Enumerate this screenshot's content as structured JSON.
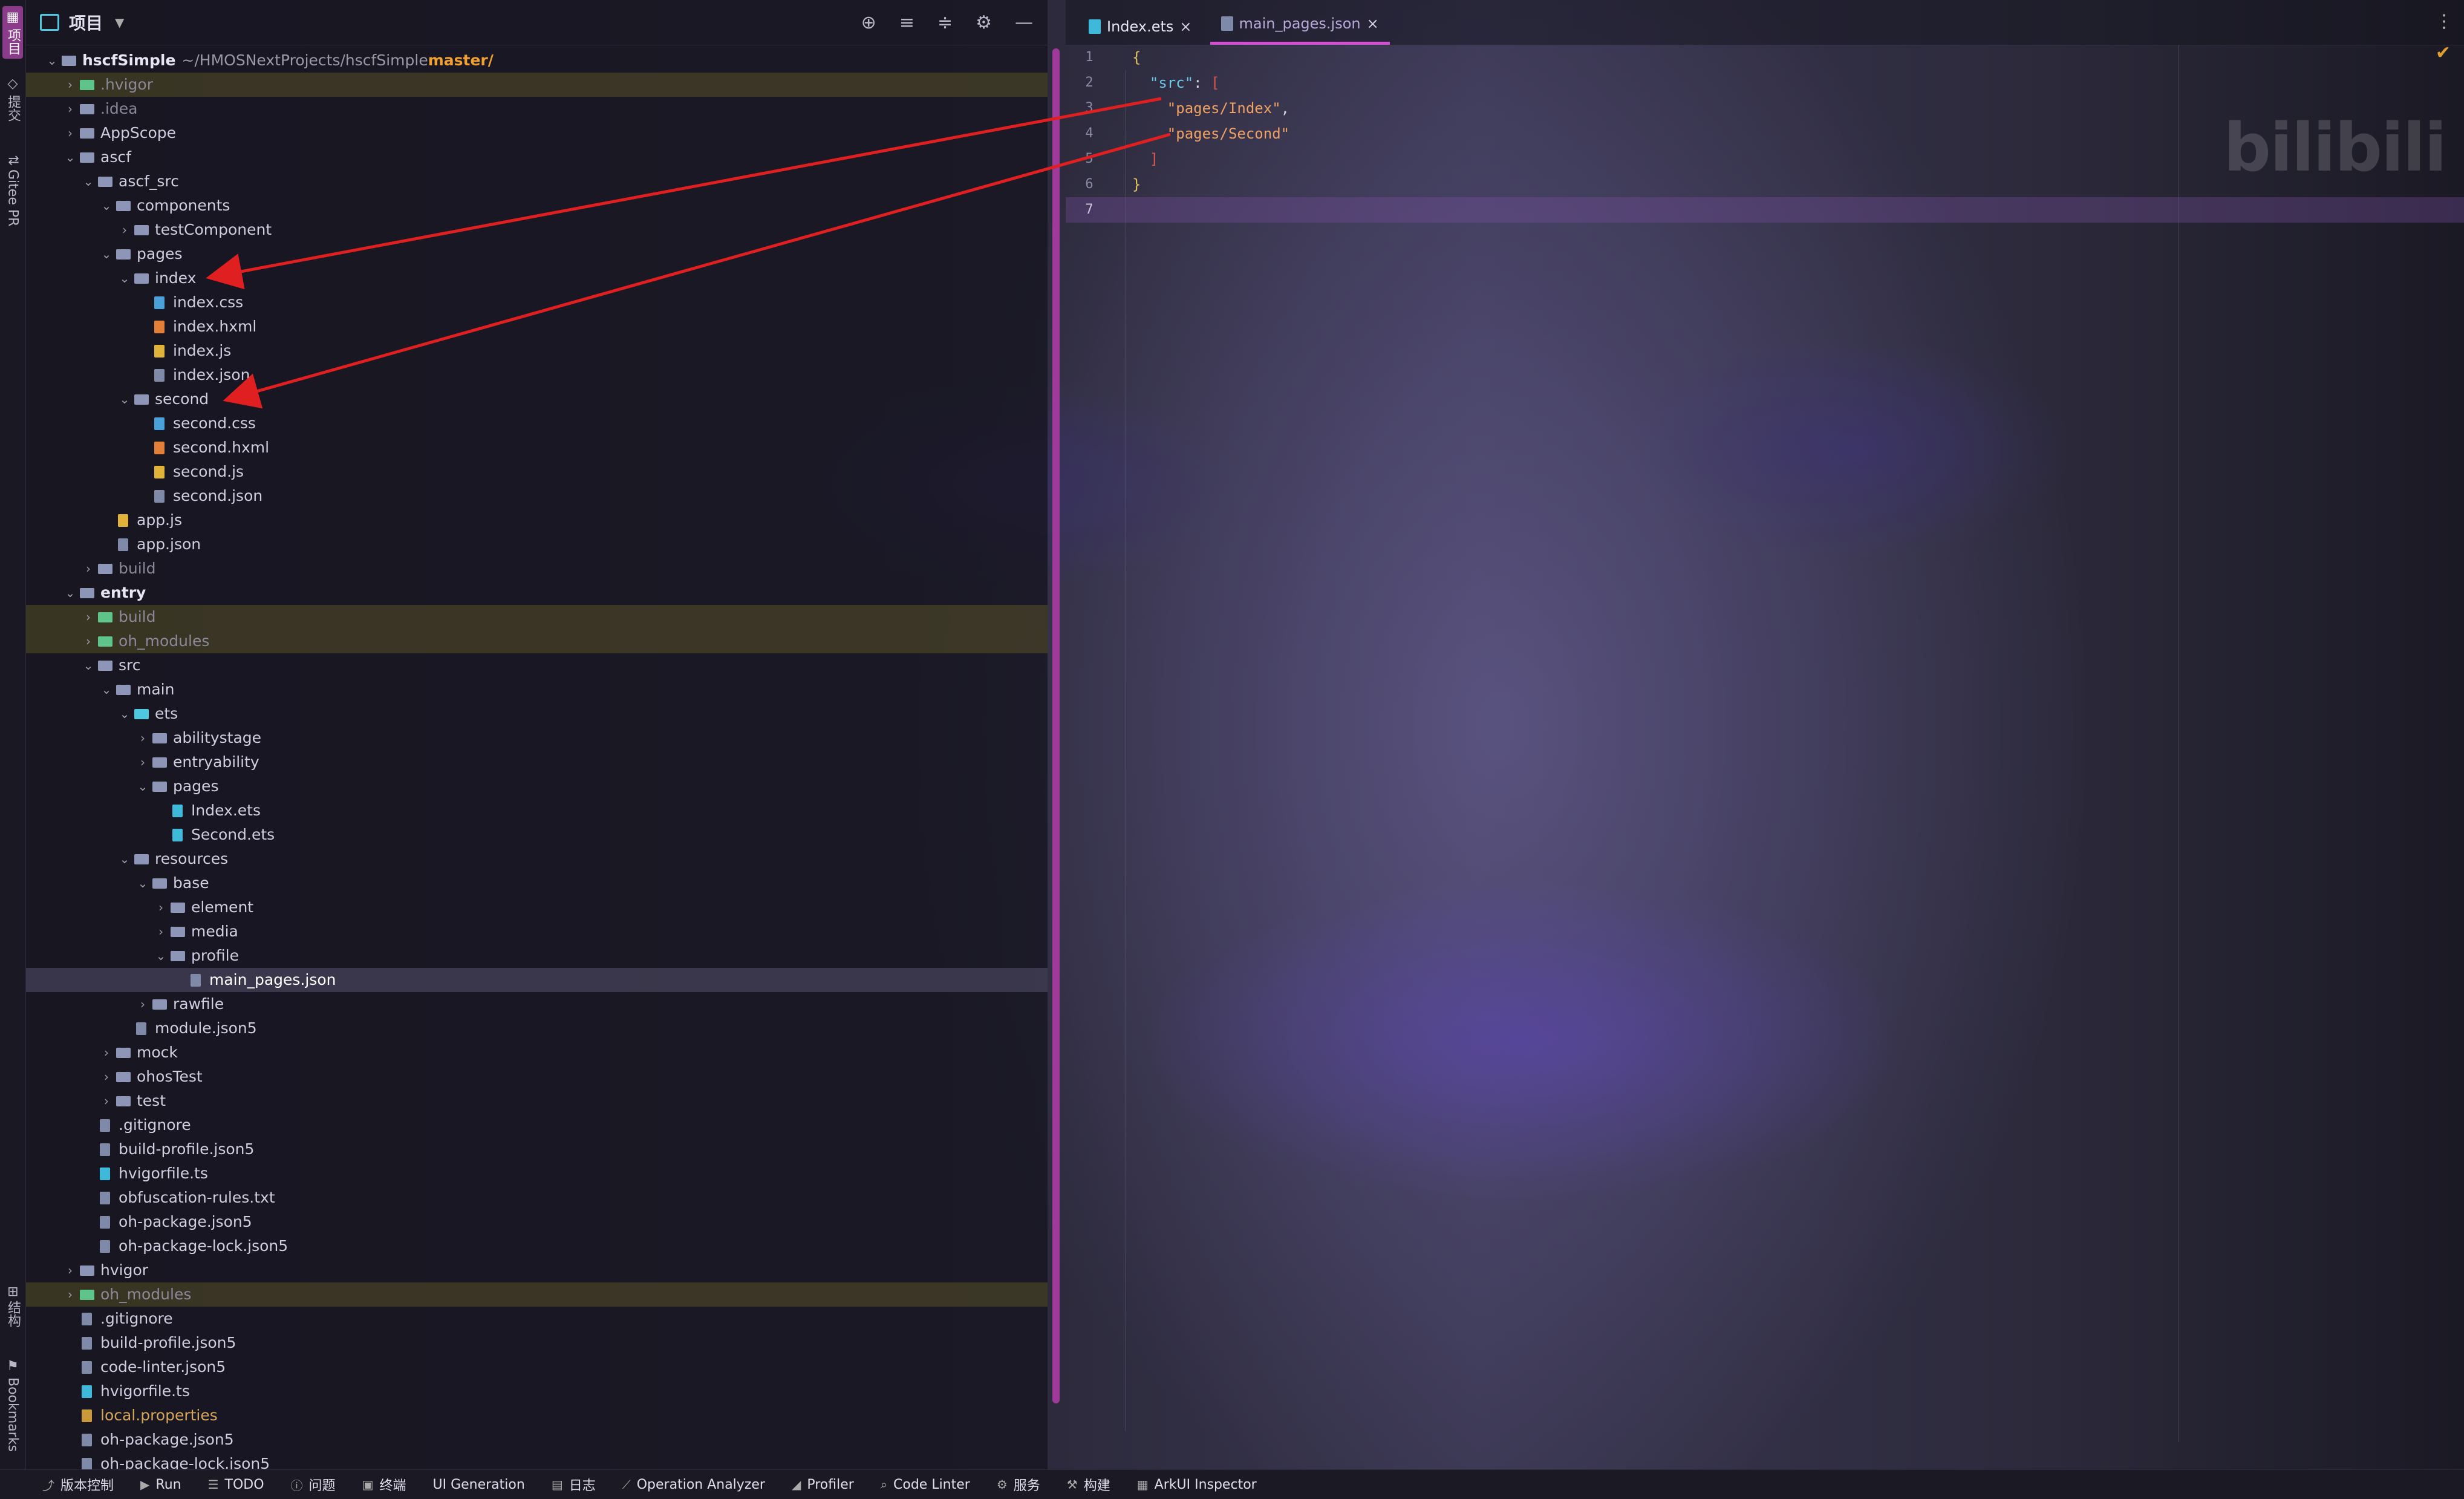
{
  "activity": {
    "top": [
      {
        "label": "项目",
        "active": true
      },
      {
        "label": "提交",
        "active": false
      },
      {
        "label": "Gitee PR",
        "active": false
      }
    ],
    "bottom": [
      {
        "label": "结构",
        "active": false
      },
      {
        "label": "Bookmarks",
        "active": false
      }
    ]
  },
  "project": {
    "title": "项目",
    "tools": [
      "⊕",
      "≡",
      "≑",
      "⚙",
      "—"
    ]
  },
  "tree": [
    {
      "indent": 0,
      "chev": "v",
      "icon": "folder",
      "name": "hscfSimple",
      "style": "bold",
      "meta": "~/HMOSNextProjects/hscfSimple",
      "branch": "master/"
    },
    {
      "indent": 1,
      "chev": ">",
      "icon": "folder green",
      "name": ".hvigor",
      "style": "dim",
      "hl": true
    },
    {
      "indent": 1,
      "chev": ">",
      "icon": "folder",
      "name": ".idea",
      "style": "dim"
    },
    {
      "indent": 1,
      "chev": ">",
      "icon": "folder",
      "name": "AppScope"
    },
    {
      "indent": 1,
      "chev": "v",
      "icon": "folder",
      "name": "ascf"
    },
    {
      "indent": 2,
      "chev": "v",
      "icon": "folder",
      "name": "ascf_src"
    },
    {
      "indent": 3,
      "chev": "v",
      "icon": "folder",
      "name": "components"
    },
    {
      "indent": 4,
      "chev": ">",
      "icon": "folder",
      "name": "testComponent"
    },
    {
      "indent": 3,
      "chev": "v",
      "icon": "folder",
      "name": "pages"
    },
    {
      "indent": 4,
      "chev": "v",
      "icon": "folder",
      "name": "index"
    },
    {
      "indent": 5,
      "chev": "",
      "icon": "file css",
      "name": "index.css"
    },
    {
      "indent": 5,
      "chev": "",
      "icon": "file hxml",
      "name": "index.hxml"
    },
    {
      "indent": 5,
      "chev": "",
      "icon": "file js",
      "name": "index.js"
    },
    {
      "indent": 5,
      "chev": "",
      "icon": "file",
      "name": "index.json"
    },
    {
      "indent": 4,
      "chev": "v",
      "icon": "folder",
      "name": "second"
    },
    {
      "indent": 5,
      "chev": "",
      "icon": "file css",
      "name": "second.css"
    },
    {
      "indent": 5,
      "chev": "",
      "icon": "file hxml",
      "name": "second.hxml"
    },
    {
      "indent": 5,
      "chev": "",
      "icon": "file js",
      "name": "second.js"
    },
    {
      "indent": 5,
      "chev": "",
      "icon": "file",
      "name": "second.json"
    },
    {
      "indent": 3,
      "chev": "",
      "icon": "file js",
      "name": "app.js"
    },
    {
      "indent": 3,
      "chev": "",
      "icon": "file",
      "name": "app.json"
    },
    {
      "indent": 2,
      "chev": ">",
      "icon": "folder",
      "name": "build",
      "style": "dim"
    },
    {
      "indent": 1,
      "chev": "v",
      "icon": "folder",
      "name": "entry",
      "style": "bold"
    },
    {
      "indent": 2,
      "chev": ">",
      "icon": "folder green",
      "name": "build",
      "style": "dim",
      "hl": true
    },
    {
      "indent": 2,
      "chev": ">",
      "icon": "folder green",
      "name": "oh_modules",
      "style": "dim",
      "hl": true
    },
    {
      "indent": 2,
      "chev": "v",
      "icon": "folder",
      "name": "src"
    },
    {
      "indent": 3,
      "chev": "v",
      "icon": "folder",
      "name": "main"
    },
    {
      "indent": 4,
      "chev": "v",
      "icon": "folder cyan",
      "name": "ets"
    },
    {
      "indent": 5,
      "chev": ">",
      "icon": "folder",
      "name": "abilitystage"
    },
    {
      "indent": 5,
      "chev": ">",
      "icon": "folder",
      "name": "entryability"
    },
    {
      "indent": 5,
      "chev": "v",
      "icon": "folder",
      "name": "pages"
    },
    {
      "indent": 6,
      "chev": "",
      "icon": "file ets",
      "name": "Index.ets"
    },
    {
      "indent": 6,
      "chev": "",
      "icon": "file ets",
      "name": "Second.ets"
    },
    {
      "indent": 4,
      "chev": "v",
      "icon": "folder",
      "name": "resources"
    },
    {
      "indent": 5,
      "chev": "v",
      "icon": "folder",
      "name": "base"
    },
    {
      "indent": 6,
      "chev": ">",
      "icon": "folder",
      "name": "element"
    },
    {
      "indent": 6,
      "chev": ">",
      "icon": "folder",
      "name": "media"
    },
    {
      "indent": 6,
      "chev": "v",
      "icon": "folder",
      "name": "profile"
    },
    {
      "indent": 7,
      "chev": "",
      "icon": "file",
      "name": "main_pages.json",
      "sel": true
    },
    {
      "indent": 5,
      "chev": ">",
      "icon": "folder",
      "name": "rawfile"
    },
    {
      "indent": 4,
      "chev": "",
      "icon": "file",
      "name": "module.json5"
    },
    {
      "indent": 3,
      "chev": ">",
      "icon": "folder",
      "name": "mock"
    },
    {
      "indent": 3,
      "chev": ">",
      "icon": "folder",
      "name": "ohosTest"
    },
    {
      "indent": 3,
      "chev": ">",
      "icon": "folder",
      "name": "test"
    },
    {
      "indent": 2,
      "chev": "",
      "icon": "file",
      "name": ".gitignore"
    },
    {
      "indent": 2,
      "chev": "",
      "icon": "file",
      "name": "build-profile.json5"
    },
    {
      "indent": 2,
      "chev": "",
      "icon": "file ets",
      "name": "hvigorfile.ts"
    },
    {
      "indent": 2,
      "chev": "",
      "icon": "file",
      "name": "obfuscation-rules.txt"
    },
    {
      "indent": 2,
      "chev": "",
      "icon": "file",
      "name": "oh-package.json5"
    },
    {
      "indent": 2,
      "chev": "",
      "icon": "file",
      "name": "oh-package-lock.json5"
    },
    {
      "indent": 1,
      "chev": ">",
      "icon": "folder",
      "name": "hvigor"
    },
    {
      "indent": 1,
      "chev": ">",
      "icon": "folder green",
      "name": "oh_modules",
      "style": "dim",
      "hl": true
    },
    {
      "indent": 1,
      "chev": "",
      "icon": "file",
      "name": ".gitignore"
    },
    {
      "indent": 1,
      "chev": "",
      "icon": "file",
      "name": "build-profile.json5"
    },
    {
      "indent": 1,
      "chev": "",
      "icon": "file",
      "name": "code-linter.json5"
    },
    {
      "indent": 1,
      "chev": "",
      "icon": "file ets",
      "name": "hvigorfile.ts"
    },
    {
      "indent": 1,
      "chev": "",
      "icon": "file prop",
      "name": "local.properties",
      "style": "orange"
    },
    {
      "indent": 1,
      "chev": "",
      "icon": "file",
      "name": "oh-package.json5"
    },
    {
      "indent": 1,
      "chev": "",
      "icon": "file",
      "name": "oh-package-lock.json5"
    }
  ],
  "editor": {
    "tabs": [
      {
        "label": "Index.ets",
        "icon": "ets",
        "active": false
      },
      {
        "label": "main_pages.json",
        "icon": "json",
        "active": true
      }
    ],
    "lines": [
      [
        {
          "t": "{",
          "c": "br"
        }
      ],
      [
        {
          "t": "  ",
          "c": ""
        },
        {
          "t": "\"src\"",
          "c": "k"
        },
        {
          "t": ": ",
          "c": ""
        },
        {
          "t": "[",
          "c": "sq"
        }
      ],
      [
        {
          "t": "    ",
          "c": ""
        },
        {
          "t": "\"pages/Index\"",
          "c": "s"
        },
        {
          "t": ",",
          "c": ""
        }
      ],
      [
        {
          "t": "    ",
          "c": ""
        },
        {
          "t": "\"pages/Second\"",
          "c": "s"
        }
      ],
      [
        {
          "t": "  ",
          "c": ""
        },
        {
          "t": "]",
          "c": "sq"
        }
      ],
      [
        {
          "t": "}",
          "c": "br"
        }
      ],
      [
        {
          "t": "",
          "c": ""
        }
      ]
    ],
    "current_line": 7,
    "watermark": "bilibili"
  },
  "statusbar": [
    {
      "icon": "⤴",
      "label": "版本控制"
    },
    {
      "icon": "▶",
      "label": "Run"
    },
    {
      "icon": "☰",
      "label": "TODO"
    },
    {
      "icon": "ⓘ",
      "label": "问题"
    },
    {
      "icon": "▣",
      "label": "终端"
    },
    {
      "icon": "",
      "label": "UI Generation"
    },
    {
      "icon": "▤",
      "label": "日志"
    },
    {
      "icon": "⟋",
      "label": "Operation Analyzer"
    },
    {
      "icon": "◢",
      "label": "Profiler"
    },
    {
      "icon": "⌕",
      "label": "Code Linter"
    },
    {
      "icon": "⚙",
      "label": "服务"
    },
    {
      "icon": "⚒",
      "label": "构建"
    },
    {
      "icon": "▦",
      "label": "ArkUI Inspector"
    }
  ],
  "colors": {
    "accent": "#a03a9a",
    "arrow": "#e02020",
    "tab_underline": "#d14fd0"
  }
}
